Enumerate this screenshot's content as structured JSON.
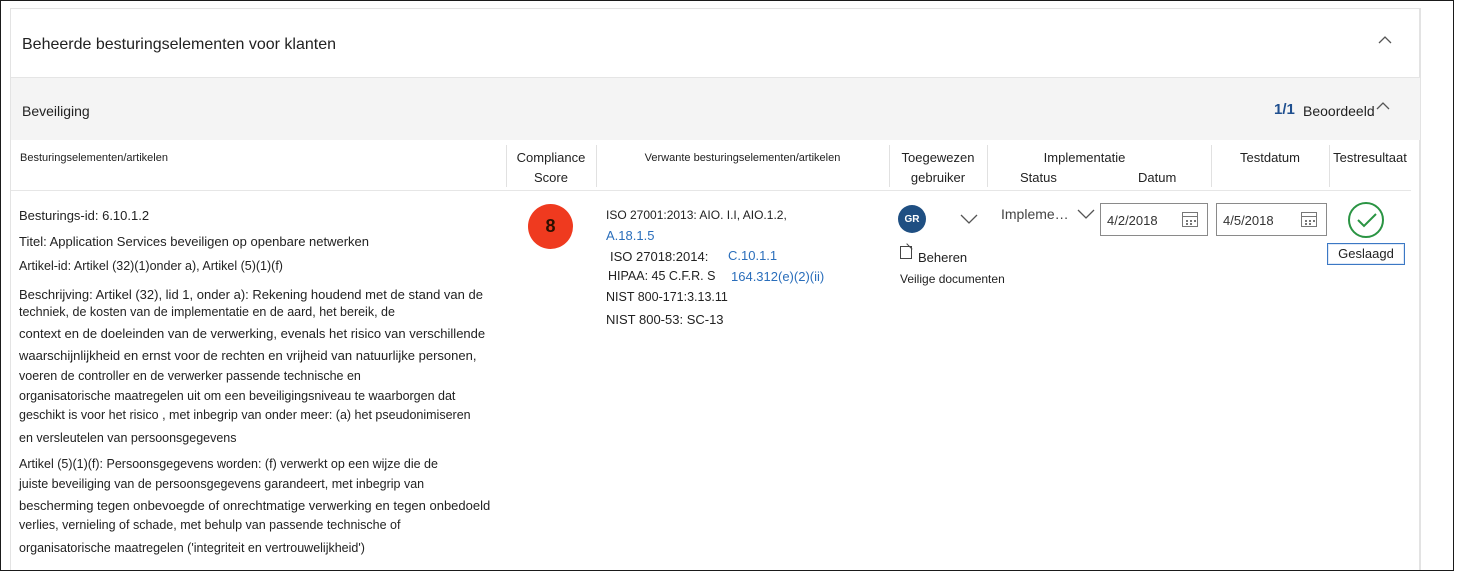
{
  "header": {
    "title": "Beheerde besturingselementen voor klanten"
  },
  "section": {
    "title": "Beveiliging",
    "count": "1/1",
    "count_label": "Beoordeeld"
  },
  "columns": {
    "controls": "Besturingselementen/artikelen",
    "score_1": "Compliance",
    "score_2": "Score",
    "related": "Verwante besturingselementen/artikelen",
    "assigned_1": "Toegewezen",
    "assigned_2": "gebruiker",
    "implementation": "Implementatie",
    "status": "Status",
    "date": "Datum",
    "test_date": "Testdatum",
    "test_result": "Testresultaat"
  },
  "row": {
    "control_id": "Besturings-id: 6.10.1.2",
    "title": "Titel: Application Services beveiligen op openbare netwerken",
    "article_id": "Artikel-id: Artikel (32)(1)onder a), Artikel (5)(1)(f)",
    "description_lines": [
      "Beschrijving: Artikel (32), lid 1, onder a): Rekening houdend met de stand van de",
      "techniek, de kosten van de implementatie en de aard, het bereik, de",
      "context en de doeleinden van de verwerking, evenals het risico van verschillende",
      "waarschijnlijkheid en ernst voor de rechten en vrijheid van natuurlijke personen,",
      "voeren de controller en de verwerker passende technische en",
      "organisatorische maatregelen uit om een beveiligingsniveau te waarborgen dat",
      "geschikt is voor het risico , met inbegrip van onder meer: (a) het pseudonimiseren",
      "en versleutelen van persoonsgegevens"
    ],
    "article_lines": [
      "Artikel (5)(1)(f): Persoonsgegevens worden: (f) verwerkt op een wijze die de",
      "juiste beveiliging van de persoonsgegevens garandeert, met inbegrip van",
      "bescherming tegen onbevoegde of onrechtmatige verwerking en tegen onbedoeld",
      "verlies, vernieling of schade, met behulp van passende technische of",
      "organisatorische maatregelen ('integriteit en vertrouwelijkheid')"
    ],
    "score": "8",
    "score_color": "#ef3a1f",
    "related": {
      "iso27001_text": "ISO 27001:2013: AIO. I.I, AIO.1.2,",
      "iso27001_link": "A.18.1.5",
      "iso27018_text": "ISO 27018:2014:",
      "iso27018_link": "C.10.1.1",
      "hipaa_text": "HIPAA: 45 C.F.R. S",
      "hipaa_link": "164.312(e)(2)(ii)",
      "nist171": "NIST 800-171:3.13.11",
      "nist53": "NIST 800-53: SC-13"
    },
    "assigned_initials": "GR",
    "manage_label": "Beheren",
    "secure_docs": "Veilige documenten",
    "status_value": "Impleme…",
    "impl_date": "4/2/2018",
    "test_date": "4/5/2018",
    "test_result": "Geslaagd"
  },
  "icons": {
    "collapse": "chevron-up-icon",
    "dropdown": "chevron-down-icon",
    "calendar": "calendar-icon",
    "passed": "checkmark-circle-icon",
    "manage": "edit-document-icon"
  },
  "colors": {
    "link": "#2a6ebb",
    "count": "#1f4f8f",
    "avatar": "#1f4f82",
    "passed": "#2a9443"
  }
}
